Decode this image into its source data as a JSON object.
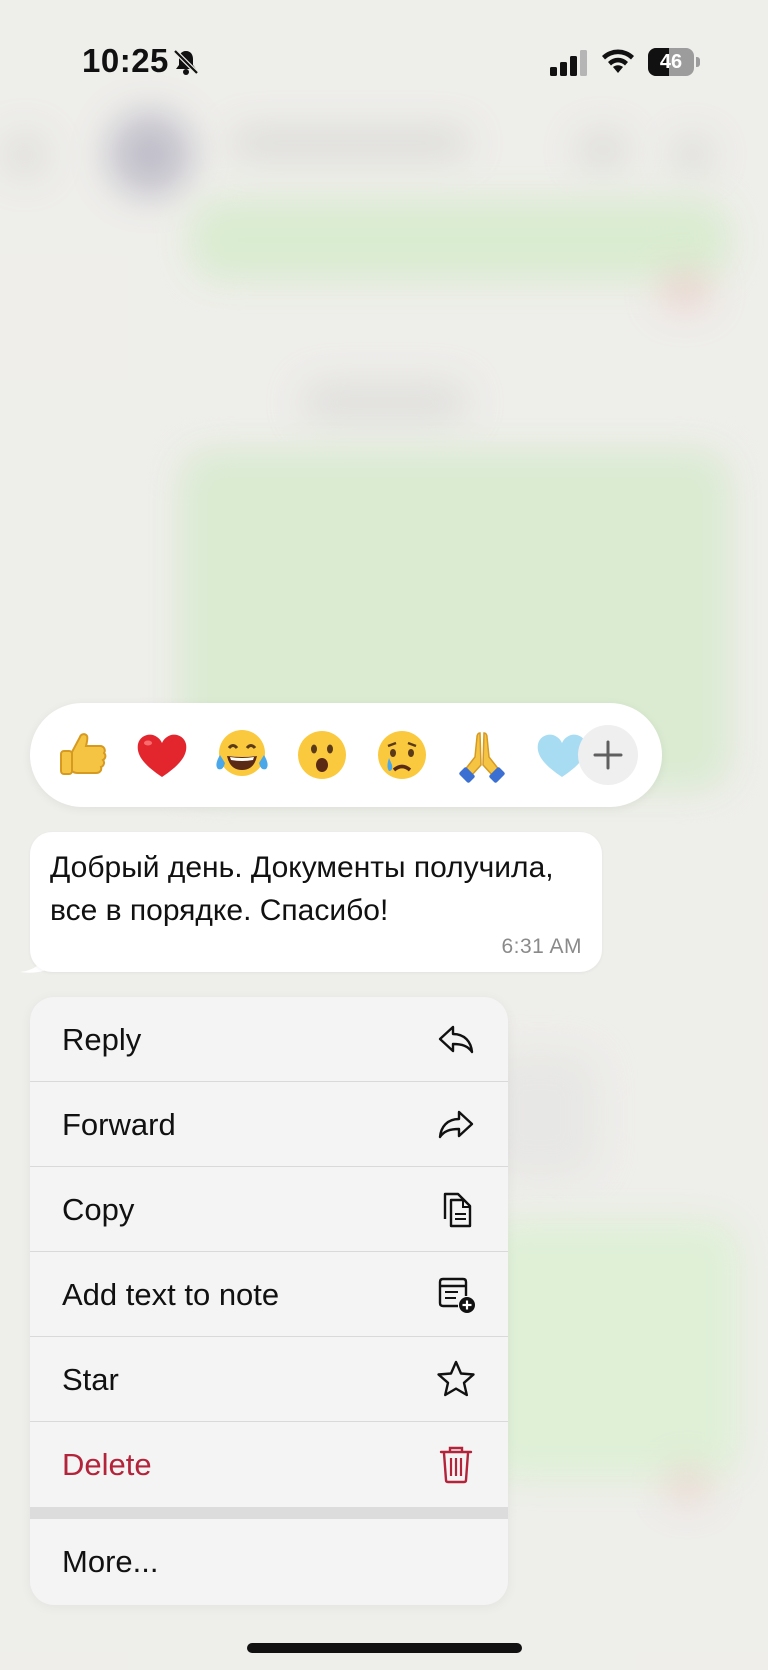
{
  "status_bar": {
    "time": "10:25",
    "battery_level": "46",
    "battery_fraction": 0.46
  },
  "reactions": {
    "items": [
      {
        "name": "thumbs-up",
        "glyph": "👍"
      },
      {
        "name": "red-heart",
        "glyph": "❤"
      },
      {
        "name": "tears-of-joy",
        "glyph": "😂"
      },
      {
        "name": "surprised",
        "glyph": "😮"
      },
      {
        "name": "crying",
        "glyph": "😢"
      },
      {
        "name": "folded-hands",
        "glyph": "🙏"
      },
      {
        "name": "light-blue-heart",
        "glyph": "🩵"
      }
    ],
    "add_icon": "plus-icon"
  },
  "message": {
    "text": "Добрый день. Документы получила, все в порядке. Спасибо!",
    "time": "6:31 AM"
  },
  "menu": {
    "reply": {
      "label": "Reply",
      "icon": "reply-icon"
    },
    "forward": {
      "label": "Forward",
      "icon": "forward-icon"
    },
    "copy": {
      "label": "Copy",
      "icon": "copy-icon"
    },
    "add_note": {
      "label": "Add text to note",
      "icon": "note-add-icon"
    },
    "star": {
      "label": "Star",
      "icon": "star-icon"
    },
    "delete": {
      "label": "Delete",
      "icon": "trash-icon",
      "color": "#b3243b"
    },
    "more": {
      "label": "More..."
    }
  },
  "colors": {
    "background": "#ecebe7",
    "menu_background": "#f4f4f4",
    "bubble_background": "#ffffff",
    "destructive": "#b3243b"
  }
}
